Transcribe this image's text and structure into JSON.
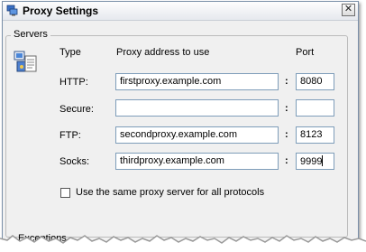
{
  "window": {
    "title": "Proxy Settings",
    "close_glyph": "✕"
  },
  "servers": {
    "group_label": "Servers",
    "icon": "network-computers-icon",
    "headers": {
      "type": "Type",
      "address": "Proxy address to use",
      "port": "Port"
    },
    "rows": [
      {
        "label": "HTTP:",
        "address": "firstproxy.example.com",
        "port": "8080"
      },
      {
        "label": "Secure:",
        "address": "",
        "port": ""
      },
      {
        "label": "FTP:",
        "address": "secondproxy.example.com",
        "port": "8123"
      },
      {
        "label": "Socks:",
        "address": "thirdproxy.example.com",
        "port": "9999"
      }
    ],
    "separator": ":",
    "same_proxy_checkbox": {
      "label": "Use the same proxy server for all protocols",
      "checked": false
    }
  },
  "exceptions": {
    "group_label": "Exceptions"
  },
  "colors": {
    "window_bg": "#f0f0f0",
    "field_border": "#7e9db9"
  }
}
